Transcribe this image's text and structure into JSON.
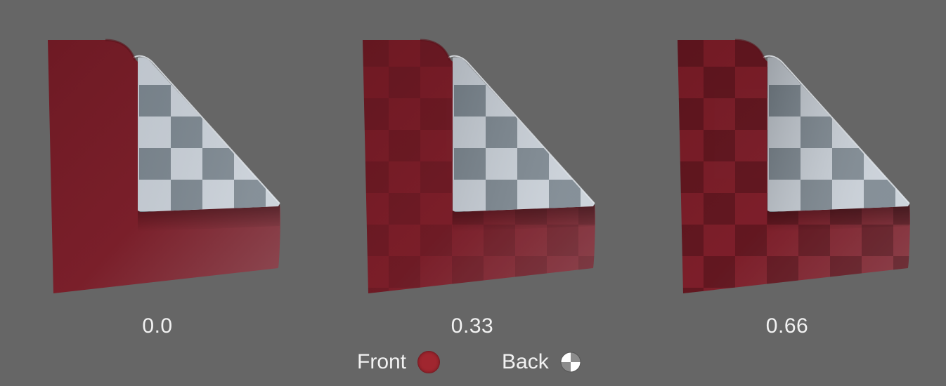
{
  "panels": [
    {
      "value_label": "0.0",
      "front_checker_opacity": 0.0
    },
    {
      "value_label": "0.33",
      "front_checker_opacity": 0.33
    },
    {
      "value_label": "0.66",
      "front_checker_opacity": 0.66
    }
  ],
  "legend": {
    "front_label": "Front",
    "back_label": "Back",
    "front_color": "#a0262f",
    "back_icon": "checker-circle-icon"
  },
  "colors": {
    "background": "#666666",
    "front_material": "#7a1c26",
    "back_light": "#c9d0d8",
    "back_dark": "#7c8790"
  }
}
